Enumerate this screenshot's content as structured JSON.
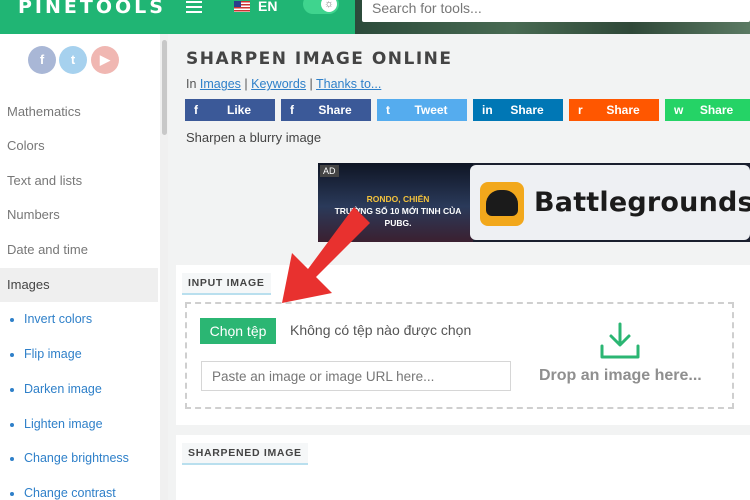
{
  "topbar": {
    "logo": "PINETOOLS",
    "language": "EN",
    "search_placeholder": "Search for tools..."
  },
  "sidebar": {
    "social": [
      {
        "name": "facebook",
        "glyph": "f"
      },
      {
        "name": "twitter",
        "glyph": "t"
      },
      {
        "name": "youtube",
        "glyph": "▶"
      }
    ],
    "categories": [
      "Mathematics",
      "Colors",
      "Text and lists",
      "Numbers",
      "Date and time",
      "Images"
    ],
    "active_category": "Images",
    "image_tools": [
      "Invert colors",
      "Flip image",
      "Darken image",
      "Lighten image",
      "Change brightness",
      "Change contrast"
    ]
  },
  "page": {
    "title": "SHARPEN IMAGE ONLINE",
    "breadcrumb": {
      "prefix": "In",
      "links": [
        "Images",
        "Keywords",
        "Thanks to..."
      ],
      "separator": "|"
    },
    "share_buttons": [
      {
        "label": "Like",
        "icon": "f",
        "color": "#3b5998"
      },
      {
        "label": "Share",
        "icon": "f",
        "color": "#3b5998"
      },
      {
        "label": "Tweet",
        "icon": "t",
        "color": "#55acee"
      },
      {
        "label": "Share",
        "icon": "in",
        "color": "#0077b5"
      },
      {
        "label": "Share",
        "icon": "r",
        "color": "#ff5700"
      },
      {
        "label": "Share",
        "icon": "w",
        "color": "#25d366"
      }
    ],
    "subtitle": "Sharpen a blurry image"
  },
  "ad": {
    "badge": "AD",
    "text_line1": "RONDO, CHIẾN",
    "text_line2": "TRƯỜNG SỐ 10 MỚI TINH CỦA PUBG.",
    "brand": "Battlegrounds"
  },
  "input_section": {
    "label": "INPUT IMAGE",
    "choose_button": "Chọn tệp",
    "no_file_text": "Không có tệp nào được chọn",
    "url_placeholder": "Paste an image or image URL here...",
    "drop_text": "Drop an image here..."
  },
  "output_section": {
    "label": "SHARPENED IMAGE"
  },
  "colors": {
    "brand_green": "#20b574",
    "button_green": "#2bb673",
    "link_blue": "#2f80c9",
    "annotation_red": "#e8312f"
  }
}
